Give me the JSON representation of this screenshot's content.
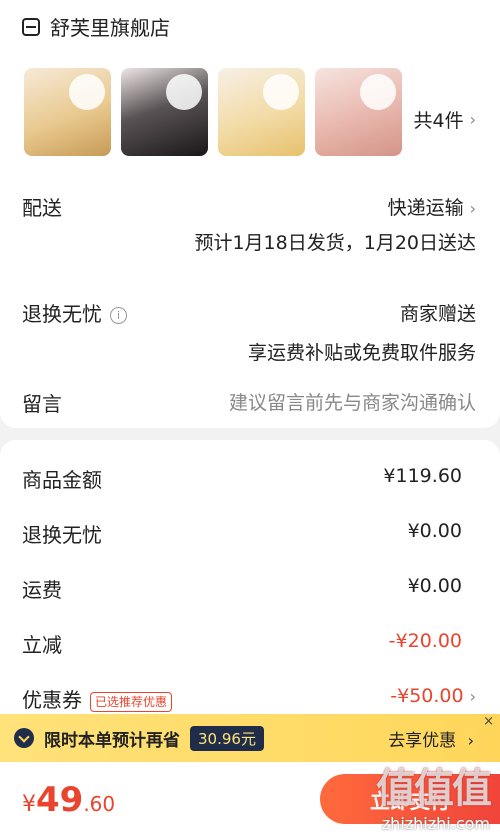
{
  "store": {
    "name": "舒芙里旗舰店",
    "icon": "shop-icon"
  },
  "goods": {
    "thumbnails": [
      "cake-image-1",
      "cake-image-2",
      "cake-image-3",
      "cake-image-4"
    ],
    "count_label": "共4件"
  },
  "delivery": {
    "label": "配送",
    "method": "快递运输",
    "estimate": "预计1月18日发货，1月20日送达"
  },
  "return_service": {
    "label": "退换无忧",
    "value": "商家赠送",
    "desc": "享运费补贴或免费取件服务"
  },
  "message": {
    "label": "留言",
    "placeholder": "建议留言前先与商家沟通确认"
  },
  "amounts": [
    {
      "label": "商品金额",
      "value": "¥119.60"
    },
    {
      "label": "退换无忧",
      "value": "¥0.00"
    },
    {
      "label": "运费",
      "value": "¥0.00"
    },
    {
      "label": "立减",
      "value": "-¥20.00"
    },
    {
      "label": "优惠券",
      "badge": "已选推荐优惠",
      "value": "-¥50.00"
    }
  ],
  "promo": {
    "text": "限时本单预计再省",
    "amount": "30.96元",
    "cta": "去享优惠",
    "close": "×"
  },
  "footer": {
    "currency": "¥",
    "price_int": "49",
    "price_dec": ".60",
    "pay_label": "立即支付"
  },
  "watermark": {
    "big": "值值值",
    "small": "zhizhizhi.com"
  },
  "colors": {
    "accent": "#e9452e",
    "promo_bg": "#ffd65a",
    "promo_dark": "#1f2d4a"
  }
}
